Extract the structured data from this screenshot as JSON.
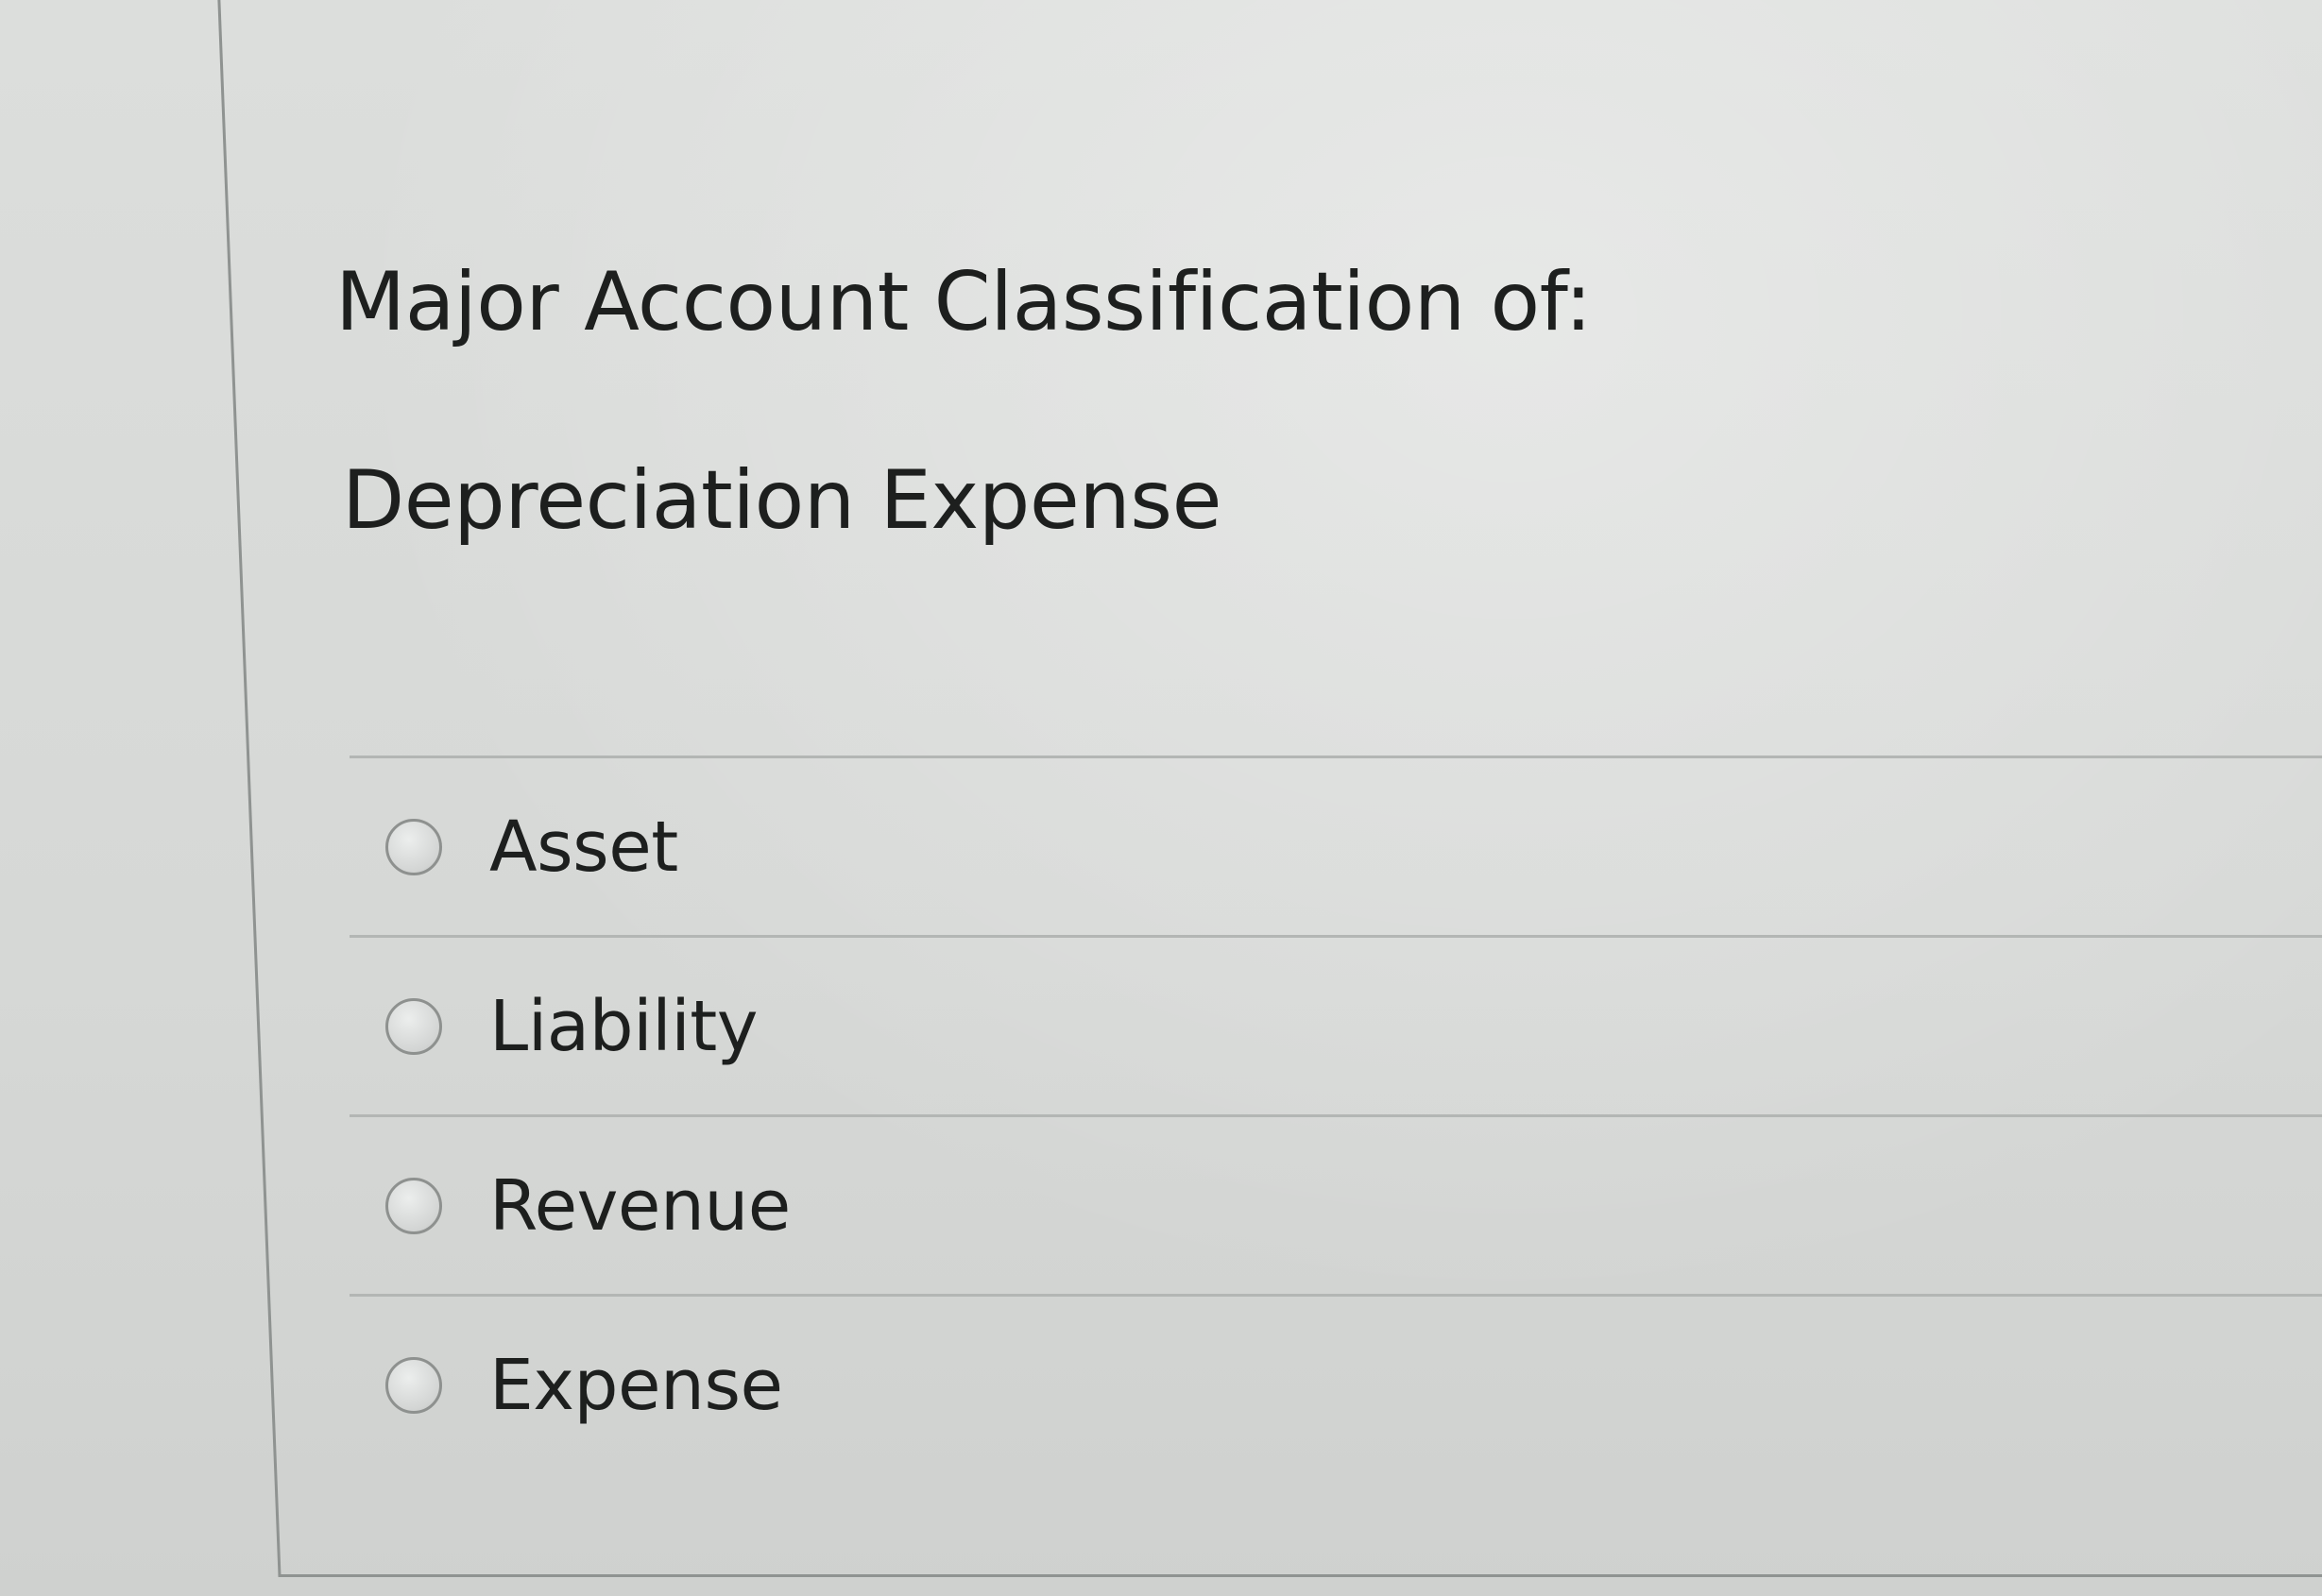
{
  "question": {
    "prompt": "Major Account Classification of:",
    "term": "Depreciation Expense"
  },
  "options": [
    {
      "label": "Asset",
      "selected": false
    },
    {
      "label": "Liability",
      "selected": false
    },
    {
      "label": "Revenue",
      "selected": false
    },
    {
      "label": "Expense",
      "selected": false
    }
  ]
}
